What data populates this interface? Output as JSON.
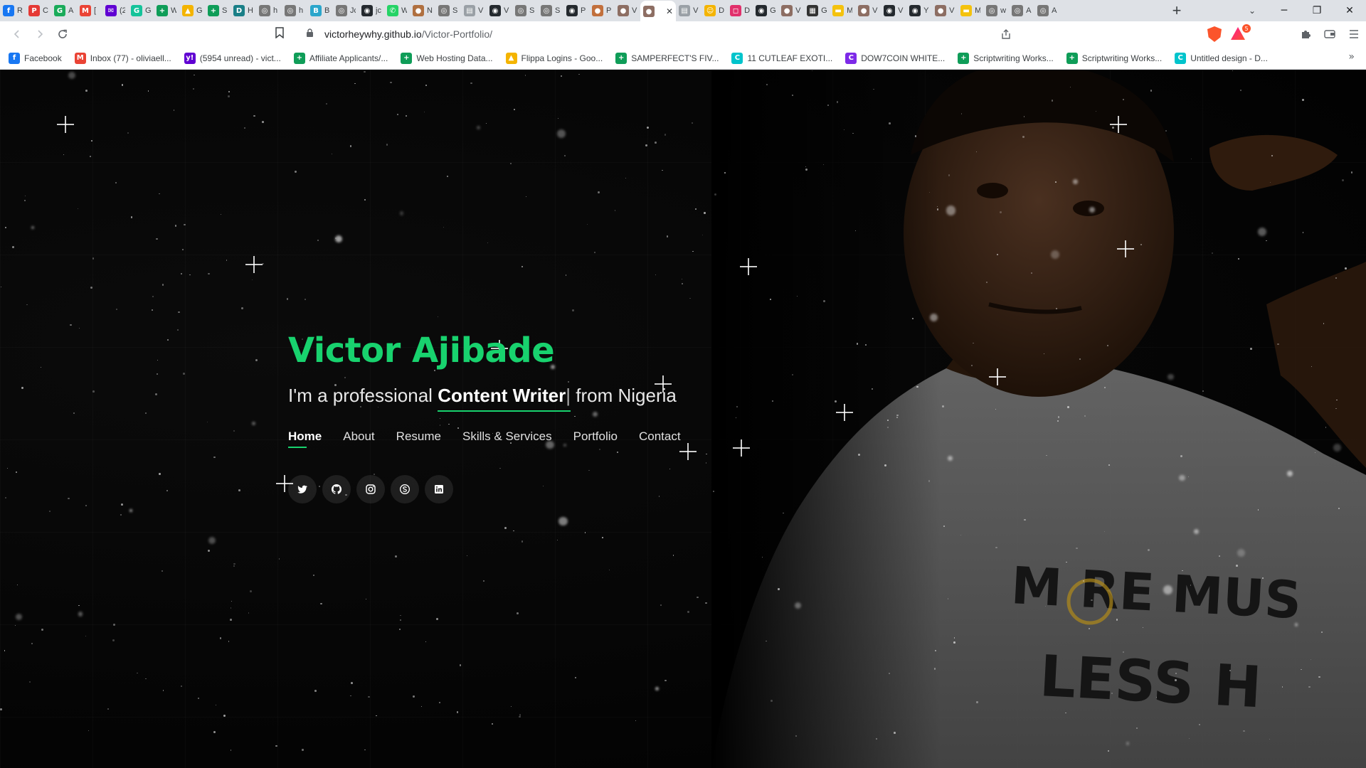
{
  "browser": {
    "tabs": [
      {
        "icon": "facebook-icon",
        "initial": "f",
        "color": "#1877f2",
        "title": "R"
      },
      {
        "icon": "p-icon",
        "initial": "P",
        "color": "#e53935",
        "title": "C"
      },
      {
        "icon": "green-circle-icon",
        "initial": "G",
        "color": "#1aab5a",
        "title": "A"
      },
      {
        "icon": "gmail-icon",
        "initial": "M",
        "color": "#ea4335",
        "title": "["
      },
      {
        "icon": "yahoo-mail-icon",
        "initial": "✉",
        "color": "#6001d2",
        "title": "(2"
      },
      {
        "icon": "grammarly-icon",
        "initial": "G",
        "color": "#15c39a",
        "title": "G"
      },
      {
        "icon": "sheets-icon",
        "initial": "+",
        "color": "#0f9d58",
        "title": "W"
      },
      {
        "icon": "drive-icon",
        "initial": "▲",
        "color": "#f4b400",
        "title": "G"
      },
      {
        "icon": "sheets-icon",
        "initial": "+",
        "color": "#0f9d58",
        "title": "S"
      },
      {
        "icon": "dev-icon",
        "initial": "D",
        "color": "#1a7f87",
        "title": "H"
      },
      {
        "icon": "globe-icon",
        "initial": "◎",
        "color": "#777777",
        "title": "h"
      },
      {
        "icon": "globe-icon",
        "initial": "◎",
        "color": "#777777",
        "title": "h"
      },
      {
        "icon": "b-icon",
        "initial": "B",
        "color": "#2ba6cb",
        "title": "B"
      },
      {
        "icon": "globe-icon",
        "initial": "◎",
        "color": "#777777",
        "title": "Jc"
      },
      {
        "icon": "github-icon",
        "initial": "◉",
        "color": "#24292e",
        "title": "jc"
      },
      {
        "icon": "whatsapp-icon",
        "initial": "✆",
        "color": "#25d366",
        "title": "W"
      },
      {
        "icon": "avatar-icon",
        "initial": "●",
        "color": "#b07040",
        "title": "N"
      },
      {
        "icon": "globe-icon",
        "initial": "◎",
        "color": "#777777",
        "title": "S"
      },
      {
        "icon": "page-icon",
        "initial": "▤",
        "color": "#9aa0a6",
        "title": "V"
      },
      {
        "icon": "github-icon",
        "initial": "◉",
        "color": "#24292e",
        "title": "V"
      },
      {
        "icon": "globe-icon",
        "initial": "◎",
        "color": "#777777",
        "title": "S"
      },
      {
        "icon": "globe-icon",
        "initial": "◎",
        "color": "#777777",
        "title": "S"
      },
      {
        "icon": "github-icon",
        "initial": "◉",
        "color": "#24292e",
        "title": "P"
      },
      {
        "icon": "avatar-icon",
        "initial": "●",
        "color": "#c2703d",
        "title": "P"
      },
      {
        "icon": "avatar-icon",
        "initial": "●",
        "color": "#8d6e63",
        "title": "V"
      },
      {
        "icon": "avatar-icon",
        "initial": "●",
        "color": "#8d6e63",
        "title": "",
        "active": true
      },
      {
        "icon": "page-icon",
        "initial": "▤",
        "color": "#9aa0a6",
        "title": "V"
      },
      {
        "icon": "emoji-icon",
        "initial": "☺",
        "color": "#f4b400",
        "title": "D"
      },
      {
        "icon": "instagram-icon",
        "initial": "◻",
        "color": "#e1306c",
        "title": "D"
      },
      {
        "icon": "github-icon",
        "initial": "◉",
        "color": "#24292e",
        "title": "G"
      },
      {
        "icon": "avatar-icon",
        "initial": "●",
        "color": "#8d6e63",
        "title": "V"
      },
      {
        "icon": "qr-icon",
        "initial": "▦",
        "color": "#333333",
        "title": "G"
      },
      {
        "icon": "tag-icon",
        "initial": "▬",
        "color": "#f4c20d",
        "title": "M"
      },
      {
        "icon": "avatar-icon",
        "initial": "●",
        "color": "#8d6e63",
        "title": "V"
      },
      {
        "icon": "github-icon",
        "initial": "◉",
        "color": "#24292e",
        "title": "V"
      },
      {
        "icon": "github-icon",
        "initial": "◉",
        "color": "#24292e",
        "title": "Y"
      },
      {
        "icon": "avatar-icon",
        "initial": "●",
        "color": "#8d6e63",
        "title": "V"
      },
      {
        "icon": "tag-icon",
        "initial": "▬",
        "color": "#f4c20d",
        "title": "M"
      },
      {
        "icon": "globe-icon",
        "initial": "◎",
        "color": "#777777",
        "title": "w"
      },
      {
        "icon": "globe-icon",
        "initial": "◎",
        "color": "#777777",
        "title": "A"
      },
      {
        "icon": "globe-icon",
        "initial": "◎",
        "color": "#777777",
        "title": "A"
      }
    ],
    "new_tab": "+",
    "url_prefix": "victorheywhy.github.io",
    "url_path": "/Victor-Portfolio/",
    "rewards_badge": "5",
    "bookmarks": [
      {
        "icon": "facebook-icon",
        "initial": "f",
        "color": "#1877f2",
        "label": "Facebook"
      },
      {
        "icon": "gmail-icon",
        "initial": "M",
        "color": "#ea4335",
        "label": "Inbox (77) - oliviaell..."
      },
      {
        "icon": "yahoo-icon",
        "initial": "y!",
        "color": "#6001d2",
        "label": "(5954 unread) - vict..."
      },
      {
        "icon": "sheets-icon",
        "initial": "+",
        "color": "#0f9d58",
        "label": "Affiliate Applicants/..."
      },
      {
        "icon": "sheets-icon",
        "initial": "+",
        "color": "#0f9d58",
        "label": "Web Hosting Data..."
      },
      {
        "icon": "drive-icon",
        "initial": "▲",
        "color": "#f4b400",
        "label": "Flippa Logins - Goo..."
      },
      {
        "icon": "sheets-icon",
        "initial": "+",
        "color": "#0f9d58",
        "label": "SAMPERFECT'S FIV..."
      },
      {
        "icon": "canva-icon",
        "initial": "C",
        "color": "#00c4cc",
        "label": "11 CUTLEAF EXOTI..."
      },
      {
        "icon": "canva-icon",
        "initial": "C",
        "color": "#7d2ae8",
        "label": "DOW7COIN WHITE..."
      },
      {
        "icon": "sheets-icon",
        "initial": "+",
        "color": "#0f9d58",
        "label": "Scriptwriting Works..."
      },
      {
        "icon": "sheets-icon",
        "initial": "+",
        "color": "#0f9d58",
        "label": "Scriptwriting Works..."
      },
      {
        "icon": "canva-icon",
        "initial": "C",
        "color": "#00c4cc",
        "label": "Untitled design - D..."
      }
    ]
  },
  "hero": {
    "name": "Victor Ajibade",
    "tagline_prefix": "I'm a professional",
    "tagline_typed": "Content Writer",
    "tagline_cursor": "|",
    "tagline_suffix": "from Nigeria",
    "accent_color": "#18d26e"
  },
  "nav": {
    "home": "Home",
    "about": "About",
    "resume": "Resume",
    "skills": "Skills & Services",
    "portfolio": "Portfolio",
    "contact": "Contact"
  },
  "socials": [
    "twitter-icon",
    "github-icon",
    "instagram-icon",
    "skype-icon",
    "linkedin-icon"
  ]
}
